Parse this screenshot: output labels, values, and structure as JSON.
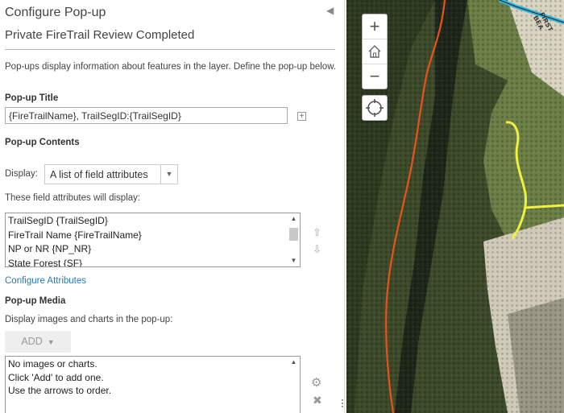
{
  "panel": {
    "title": "Configure Pop-up",
    "subtitle": "Private FireTrail Review Completed",
    "description": "Pop-ups display information about features in the layer. Define the pop-up below.",
    "popup_title_label": "Pop-up Title",
    "popup_title_value": "{FireTrailName}, TrailSegID:{TrailSegID}",
    "popup_contents_label": "Pop-up Contents",
    "display_label": "Display:",
    "display_selected": "A list of field attributes",
    "fields_note": "These field attributes will display:",
    "field_items": [
      "TrailSegID {TrailSegID}",
      "FireTrail Name {FireTrailName}",
      "NP or NR {NP_NR}",
      "State Forest {SF}"
    ],
    "configure_attributes_link": "Configure Attributes",
    "popup_media_label": "Pop-up Media",
    "media_note": "Display images and charts in the pop-up:",
    "add_button": "ADD",
    "media_lines": [
      "No images or charts.",
      "Click 'Add' to add one.",
      "Use the arrows to order."
    ]
  },
  "map": {
    "zoom_in": "+",
    "zoom_out": "−",
    "road_label": "FIRST BEA"
  },
  "icons": {
    "collapse": "collapse-left-icon",
    "plus_box": "plus-box-icon",
    "move_up": "arrow-up-icon",
    "move_down": "arrow-down-icon",
    "gear": "gear-icon",
    "delete": "close-icon",
    "home": "home-icon",
    "locate": "locate-icon"
  },
  "colors": {
    "link": "#2a7ab0",
    "trail_orange": "#e8531c",
    "trail_yellow": "#f0f040",
    "road_cyan": "#35b6e0"
  }
}
